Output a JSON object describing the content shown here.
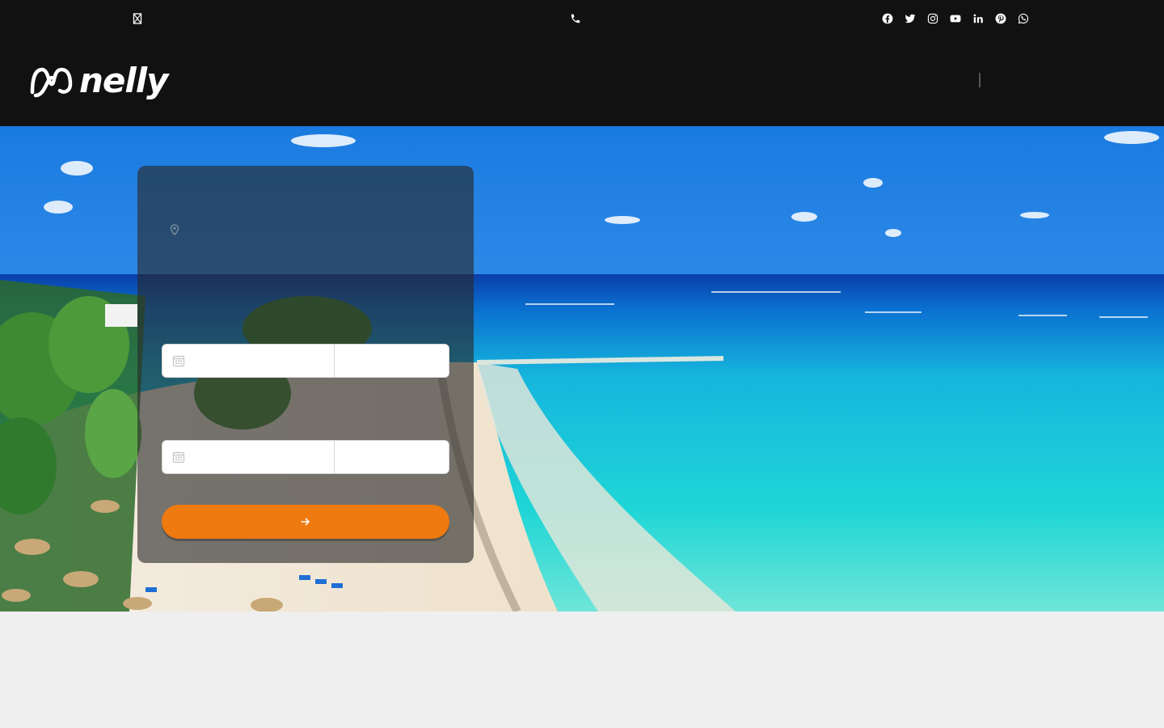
{
  "topbar": {
    "icons": {
      "email": "envelope-icon",
      "phone": "phone-icon",
      "social": [
        "facebook-icon",
        "twitter-icon",
        "instagram-icon",
        "youtube-icon",
        "linkedin-icon",
        "pinterest-icon",
        "whatsapp-icon"
      ]
    }
  },
  "header": {
    "logo_text": "nelly"
  },
  "booking": {
    "pickup_location_icon": "map-pin-icon",
    "pickup_date_icon": "calendar-icon",
    "dropoff_date_icon": "calendar-icon",
    "submit_icon": "arrow-right-icon"
  },
  "colors": {
    "header_bg": "#111111",
    "accent": "#ee7a10",
    "panel_overlay": "rgba(40,40,40,0.62)",
    "page_bg": "#efefef"
  }
}
